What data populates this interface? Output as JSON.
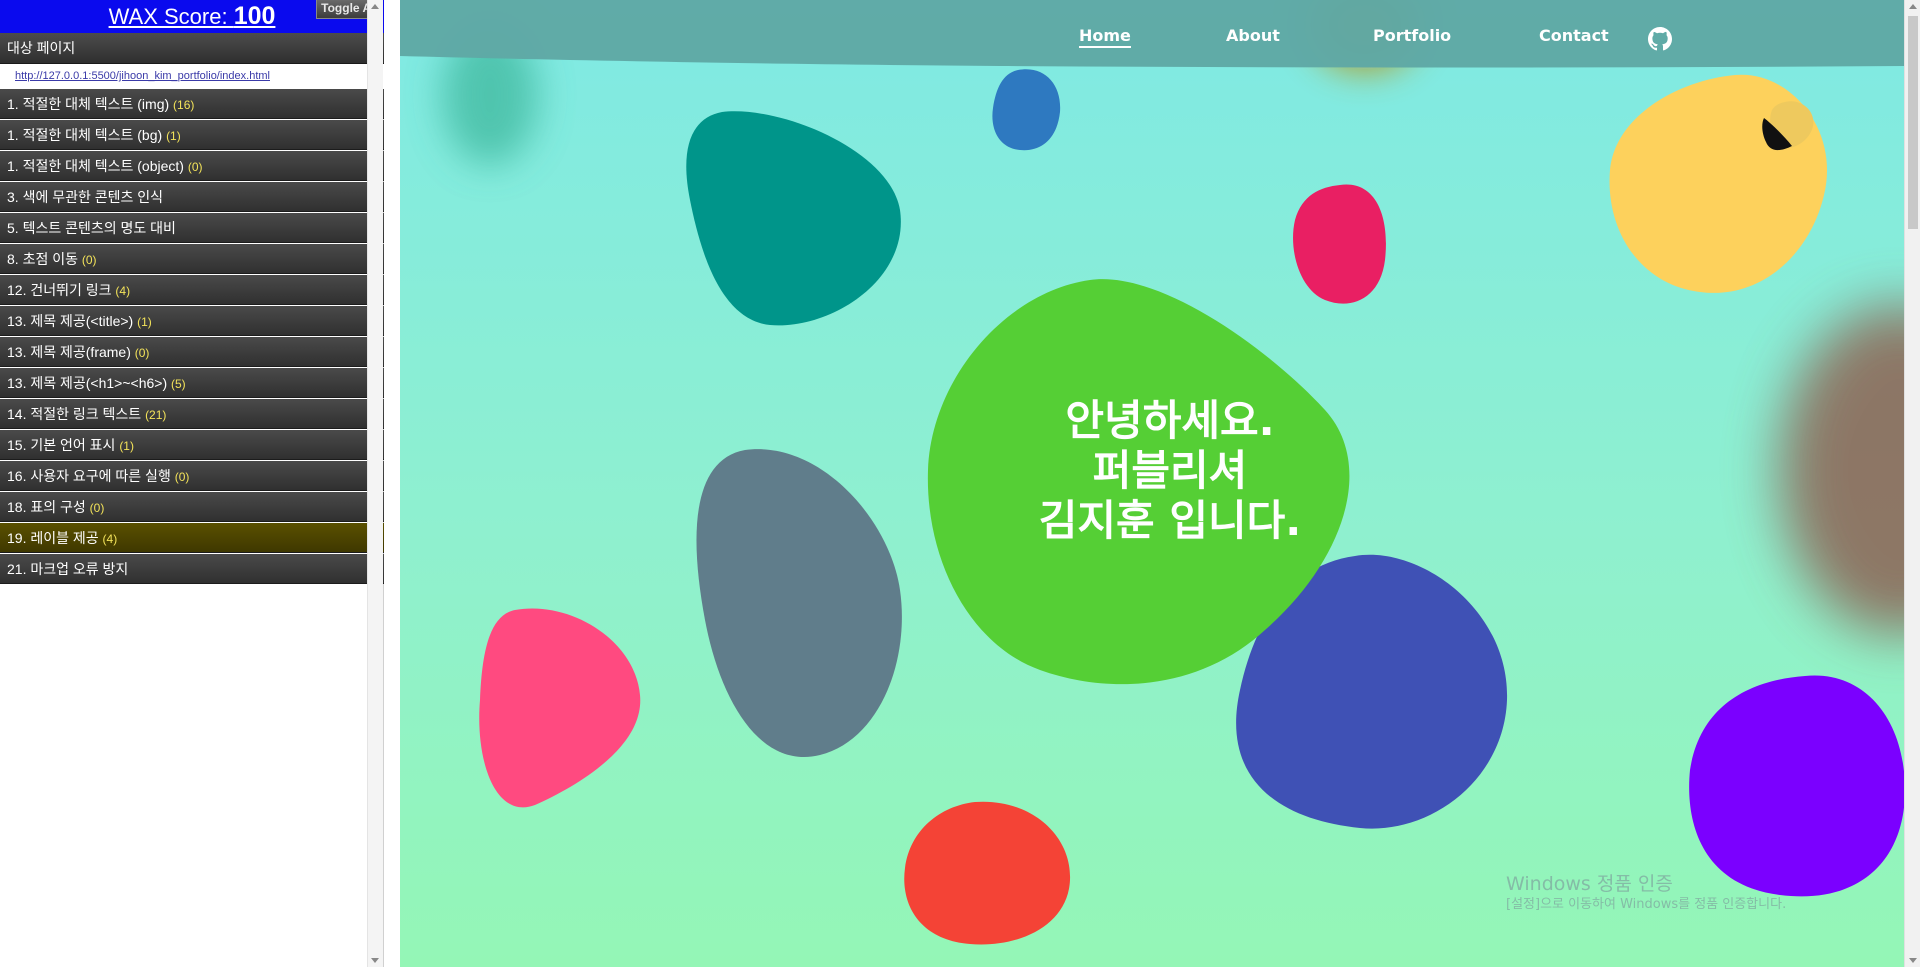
{
  "wax": {
    "score_label": "WAX Score: ",
    "score_value": "100",
    "toggle_all": "Toggle All",
    "target_page_label": "대상 페이지",
    "target_url": "http://127.0.0.1:5500/jihoon_kim_portfolio/index.html",
    "items": [
      {
        "label": "1. 적절한 대체 텍스트 (img) ",
        "count": "(16)"
      },
      {
        "label": "1. 적절한 대체 텍스트 (bg) ",
        "count": "(1)"
      },
      {
        "label": "1. 적절한 대체 텍스트 (object) ",
        "count": "(0)"
      },
      {
        "label": "3. 색에 무관한 콘텐츠 인식",
        "count": ""
      },
      {
        "label": "5. 텍스트 콘텐츠의 명도 대비",
        "count": ""
      },
      {
        "label": "8. 초점 이동 ",
        "count": "(0)"
      },
      {
        "label": "12. 건너뛰기 링크 ",
        "count": "(4)"
      },
      {
        "label": "13. 제목 제공(<title>) ",
        "count": "(1)"
      },
      {
        "label": "13. 제목 제공(frame) ",
        "count": "(0)"
      },
      {
        "label": "13. 제목 제공(<h1>~<h6>) ",
        "count": "(5)"
      },
      {
        "label": "14. 적절한 링크 텍스트 ",
        "count": "(21)"
      },
      {
        "label": "15. 기본 언어 표시 ",
        "count": "(1)"
      },
      {
        "label": "16. 사용자 요구에 따른 실행 ",
        "count": "(0)"
      },
      {
        "label": "18. 표의 구성 ",
        "count": "(0)"
      },
      {
        "label": "19. 레이블 제공 ",
        "count": "(4)"
      },
      {
        "label": "21. 마크업 오류 방지",
        "count": ""
      }
    ]
  },
  "site": {
    "nav": {
      "home": "Home",
      "about": "About",
      "portfolio": "Portfolio",
      "contact": "Contact"
    },
    "hero": {
      "line1": "안녕하세요.",
      "line2": "퍼블리셔",
      "line3": "김지훈 입니다."
    },
    "icons": {
      "github": "github-icon"
    }
  },
  "watermark": {
    "line1": "Windows 정품 인증",
    "line2": "[설정]으로 이동하여 Windows를 정품 인증합니다."
  },
  "colors": {
    "wax_header": "#0a0aee",
    "nav_band": "#5fa8a5",
    "hero_blob": "#55cf35",
    "background_top": "#7fe9e4",
    "background_bottom": "#94f6b6"
  }
}
